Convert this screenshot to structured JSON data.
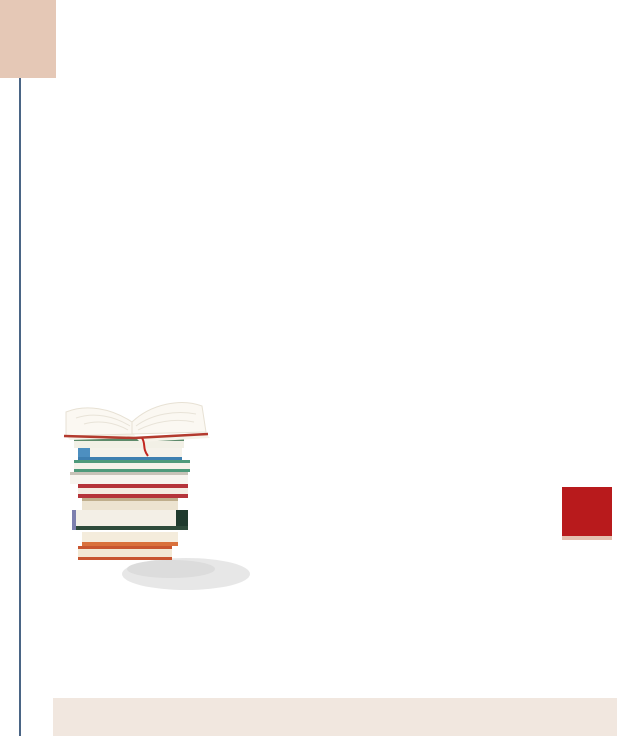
{
  "colors": {
    "background": "#ffffff",
    "corner_accent": "#e5c8b6",
    "margin_rule": "#4a6585",
    "red_square": "#b81a1c",
    "red_square_shadow": "#e5c0b0",
    "footer_band": "#f1e7df"
  },
  "illustration": {
    "icon": "stack-of-books-with-open-book-icon"
  }
}
